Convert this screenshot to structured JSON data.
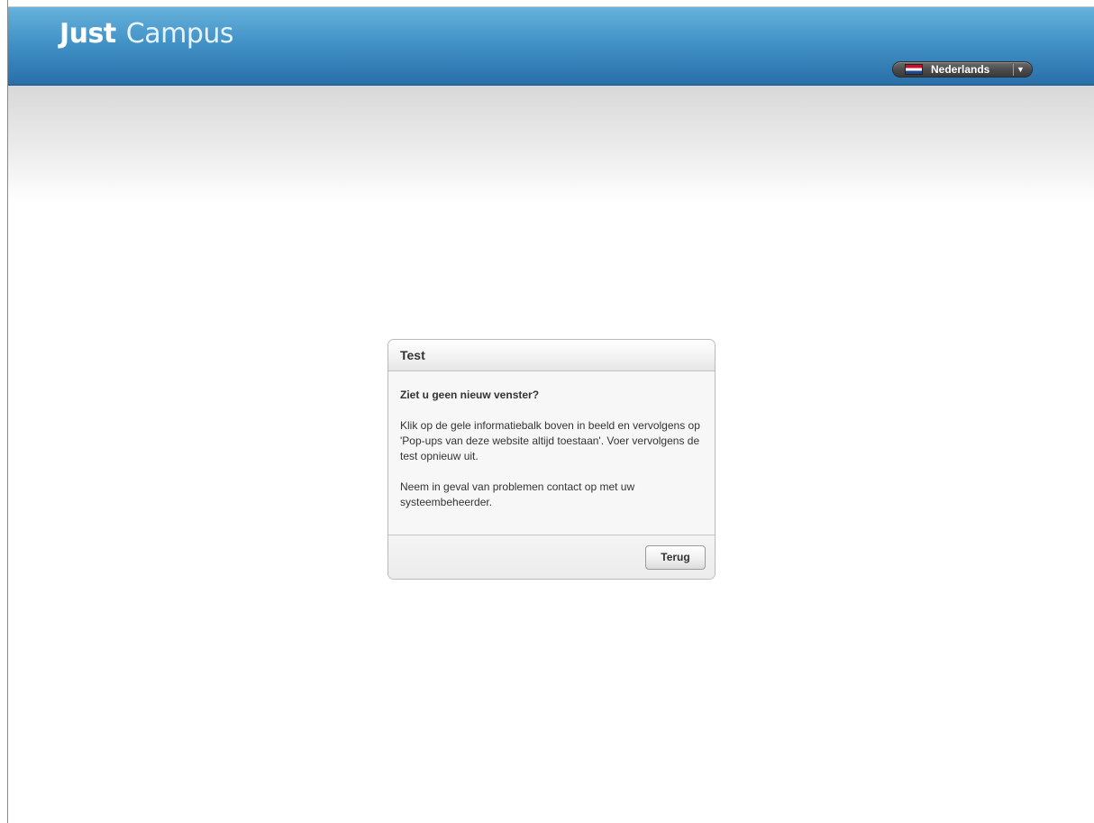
{
  "header": {
    "logo_bold": "Just",
    "logo_light": "Campus",
    "language": {
      "selected": "Nederlands",
      "flag_icon": "netherlands-flag-icon",
      "dropdown_icon": "chevron-down-icon"
    }
  },
  "colors": {
    "header_top": "#66b2db",
    "header_bottom": "#2a6ea8",
    "dialog_bg": "#f7f7f7",
    "text": "#333333"
  },
  "dialog": {
    "title": "Test",
    "heading": "Ziet u geen nieuw venster?",
    "paragraph1": "Klik op de gele informatiebalk boven in beeld en vervolgens op 'Pop-ups van deze website altijd toestaan'. Voer vervolgens de test opnieuw uit.",
    "paragraph2": "Neem in geval van problemen contact op met uw systeembeheerder.",
    "back_button": "Terug"
  }
}
